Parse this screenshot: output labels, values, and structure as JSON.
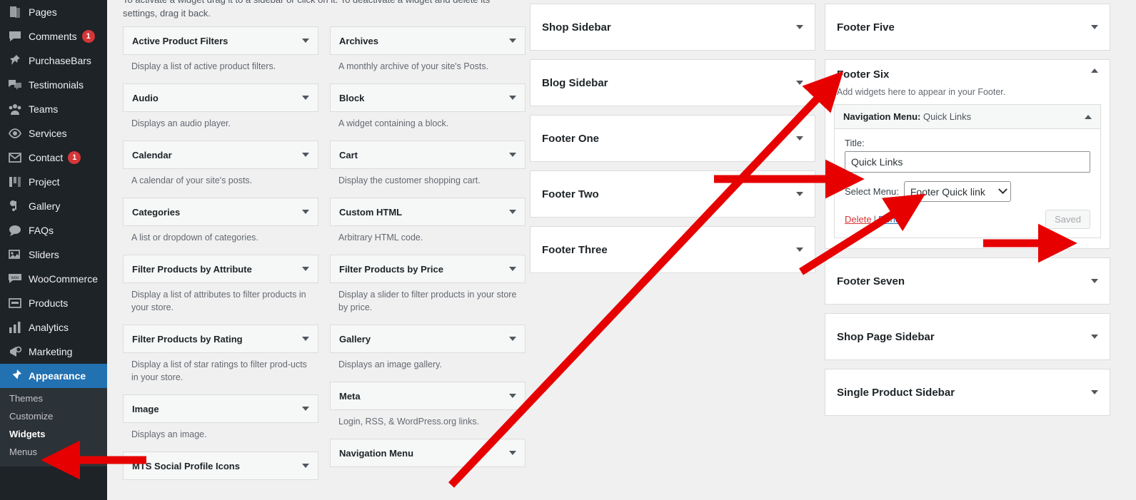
{
  "accent_colors": {
    "wp_blue": "#2271b1",
    "sidebar_bg": "#1d2327",
    "submenu_bg": "#2c3338",
    "badge_red": "#d63638",
    "annotation_red": "#e60000",
    "page_bg": "#f0f0f1"
  },
  "admin_menu": {
    "items": [
      {
        "label": "Pages",
        "icon": "pages-icon",
        "badge": ""
      },
      {
        "label": "Comments",
        "icon": "comments-icon",
        "badge": "1"
      },
      {
        "label": "PurchaseBars",
        "icon": "pin-icon",
        "badge": ""
      },
      {
        "label": "Testimonials",
        "icon": "testimonials-icon",
        "badge": ""
      },
      {
        "label": "Teams",
        "icon": "teams-icon",
        "badge": ""
      },
      {
        "label": "Services",
        "icon": "eye-icon",
        "badge": ""
      },
      {
        "label": "Contact",
        "icon": "envelope-icon",
        "badge": "1"
      },
      {
        "label": "Project",
        "icon": "project-icon",
        "badge": ""
      },
      {
        "label": "Gallery",
        "icon": "gallery-icon",
        "badge": ""
      },
      {
        "label": "FAQs",
        "icon": "faq-icon",
        "badge": ""
      },
      {
        "label": "Sliders",
        "icon": "sliders-icon",
        "badge": ""
      },
      {
        "label": "WooCommerce",
        "icon": "woocommerce-icon",
        "badge": ""
      },
      {
        "label": "Products",
        "icon": "products-icon",
        "badge": ""
      },
      {
        "label": "Analytics",
        "icon": "analytics-icon",
        "badge": ""
      },
      {
        "label": "Marketing",
        "icon": "marketing-icon",
        "badge": ""
      },
      {
        "label": "Appearance",
        "icon": "appearance-icon",
        "badge": "",
        "current": true
      }
    ],
    "submenu": [
      {
        "label": "Themes"
      },
      {
        "label": "Customize"
      },
      {
        "label": "Widgets",
        "current": true
      },
      {
        "label": "Menus"
      }
    ]
  },
  "main": {
    "intro": "To activate a widget drag it to a sidebar or click on it. To deactivate a widget and delete its settings, drag it back.",
    "available_widgets": {
      "left_column": [
        {
          "title": "Active Product Filters",
          "desc": "Display a list of active product filters."
        },
        {
          "title": "Audio",
          "desc": "Displays an audio player."
        },
        {
          "title": "Calendar",
          "desc": "A calendar of your site's posts."
        },
        {
          "title": "Categories",
          "desc": "A list or dropdown of categories."
        },
        {
          "title": "Filter Products by Attribute",
          "desc": "Display a list of attributes to filter products in your store."
        },
        {
          "title": "Filter Products by Rating",
          "desc": "Display a list of star ratings to filter prod-ucts in your store."
        },
        {
          "title": "Image",
          "desc": "Displays an image."
        },
        {
          "title": "MTS Social Profile Icons",
          "desc": ""
        }
      ],
      "right_column": [
        {
          "title": "Archives",
          "desc": "A monthly archive of your site's Posts."
        },
        {
          "title": "Block",
          "desc": "A widget containing a block."
        },
        {
          "title": "Cart",
          "desc": "Display the customer shopping cart."
        },
        {
          "title": "Custom HTML",
          "desc": "Arbitrary HTML code."
        },
        {
          "title": "Filter Products by Price",
          "desc": "Display a slider to filter products in your store by price."
        },
        {
          "title": "Gallery",
          "desc": "Displays an image gallery."
        },
        {
          "title": "Meta",
          "desc": "Login, RSS, & WordPress.org links."
        },
        {
          "title": "Navigation Menu",
          "desc": ""
        }
      ]
    },
    "sidebars_middle": [
      {
        "name": "Shop Sidebar",
        "state": "collapsed"
      },
      {
        "name": "Blog Sidebar",
        "state": "collapsed"
      },
      {
        "name": "Footer One",
        "state": "collapsed"
      },
      {
        "name": "Footer Two",
        "state": "collapsed"
      },
      {
        "name": "Footer Three",
        "state": "collapsed"
      }
    ],
    "sidebars_right": [
      {
        "name": "Footer Five",
        "state": "collapsed"
      },
      {
        "name": "Footer Six",
        "state": "open",
        "description": "Add widgets here to appear in your Footer.",
        "widget": {
          "header_type": "Navigation Menu:",
          "header_title": "Quick Links",
          "title_label": "Title:",
          "title_value": "Quick Links",
          "title_placeholder": "",
          "select_label": "Select Menu:",
          "select_value": "Footer Quick link",
          "delete_label": "Delete",
          "separator": "|",
          "done_label": "Done",
          "save_label": "Saved"
        }
      },
      {
        "name": "Footer Seven",
        "state": "collapsed"
      },
      {
        "name": "Shop Page Sidebar",
        "state": "collapsed"
      },
      {
        "name": "Single Product Sidebar",
        "state": "collapsed"
      }
    ]
  },
  "annotations": {
    "arrow_to_widgets_menu": "arrow-pointing-to-widgets-menu-item",
    "arrow_to_navigation_menu_widget": "arrow-from-navigation-menu-widget-to-footer-six",
    "arrow_to_title_field": "arrow-pointing-to-title-field",
    "arrow_to_select_menu": "arrow-pointing-to-select-menu",
    "arrow_to_saved_button": "arrow-pointing-to-saved-button"
  }
}
